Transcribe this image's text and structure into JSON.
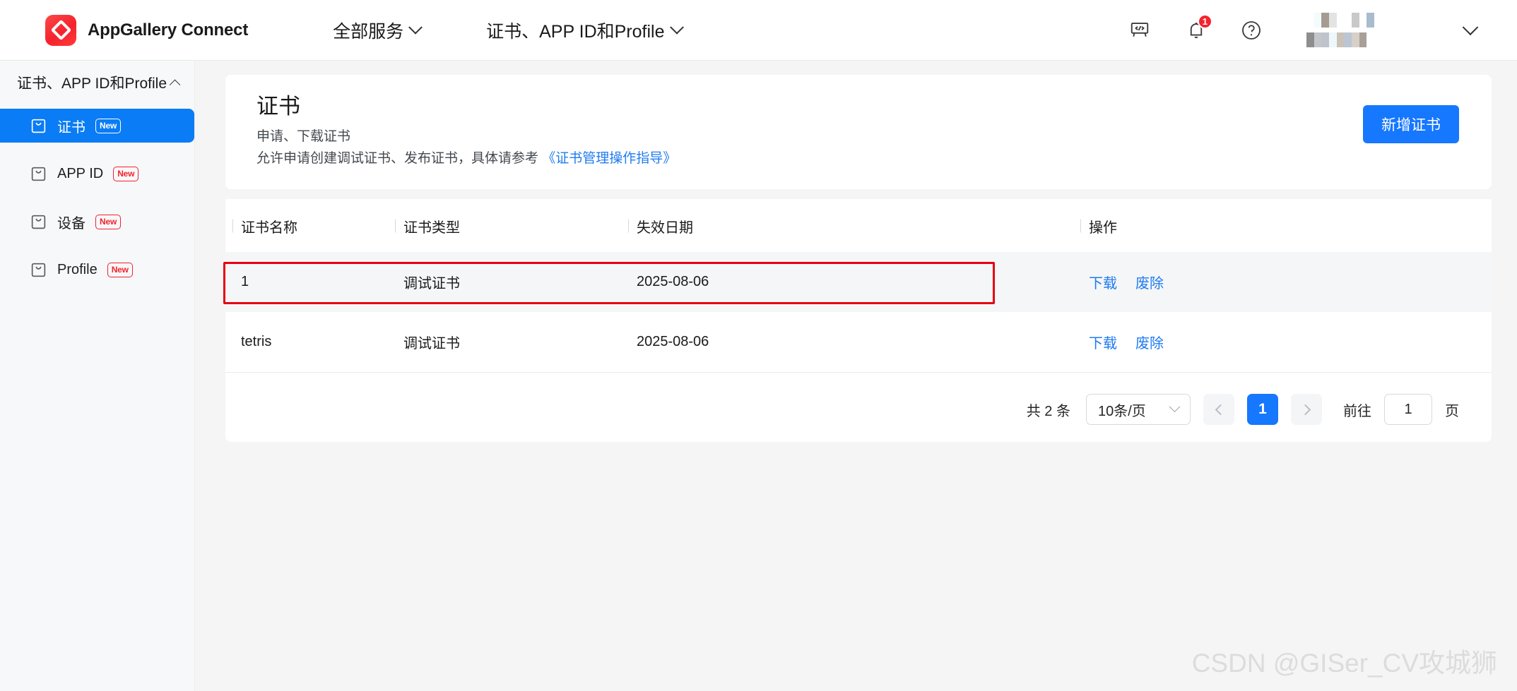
{
  "brand": {
    "name": "AppGallery Connect",
    "logo_color": "#f5222d"
  },
  "topnav": {
    "items": [
      {
        "label": "全部服务",
        "icon": "chevron-down-icon"
      },
      {
        "label": "证书、APP ID和Profile",
        "icon": "chevron-down-icon"
      }
    ],
    "icons": [
      {
        "name": "developer-board-icon"
      },
      {
        "name": "notification-bell-icon",
        "badge": "1"
      },
      {
        "name": "help-circle-icon"
      }
    ],
    "user_caret": "chevron-down-icon"
  },
  "sidebar": {
    "title": "证书、APP ID和Profile",
    "collapse_icon": "chevron-up-icon",
    "items": [
      {
        "label": "证书",
        "badge": "New",
        "active": true,
        "icon": "certificate-icon"
      },
      {
        "label": "APP ID",
        "badge": "New",
        "active": false,
        "icon": "certificate-icon"
      },
      {
        "label": "设备",
        "badge": "New",
        "active": false,
        "icon": "certificate-icon"
      },
      {
        "label": "Profile",
        "badge": "New",
        "active": false,
        "icon": "certificate-icon"
      }
    ],
    "active_color": "#0a7cf5",
    "badge_color": "#f5222d"
  },
  "hero": {
    "title": "证书",
    "line1": "申请、下载证书",
    "line2_prefix": "允许申请创建调试证书、发布证书，具体请参考 ",
    "link": "《证书管理操作指导》",
    "button": "新增证书",
    "button_color": "#1677ff",
    "link_color": "#1f7bf0"
  },
  "table": {
    "columns": [
      "证书名称",
      "证书类型",
      "失效日期",
      "操作"
    ],
    "rows": [
      {
        "name": "1",
        "type": "调试证书",
        "expiry": "2025-08-06",
        "actions": [
          "下载",
          "废除"
        ],
        "highlighted": false
      },
      {
        "name": "tetris",
        "type": "调试证书",
        "expiry": "2025-08-06",
        "actions": [
          "下载",
          "废除"
        ],
        "highlighted": true
      }
    ],
    "highlight_color": "#e60012"
  },
  "pagination": {
    "total": "共 2 条",
    "page_size": "10条/页",
    "page_size_caret": "chevron-down-icon",
    "prev_icon": "chevron-left-icon",
    "next_icon": "chevron-right-icon",
    "current_page": "1",
    "goto_label": "前往",
    "goto_value": "1",
    "goto_unit": "页"
  },
  "watermark": "CSDN @GISer_CV攻城狮"
}
